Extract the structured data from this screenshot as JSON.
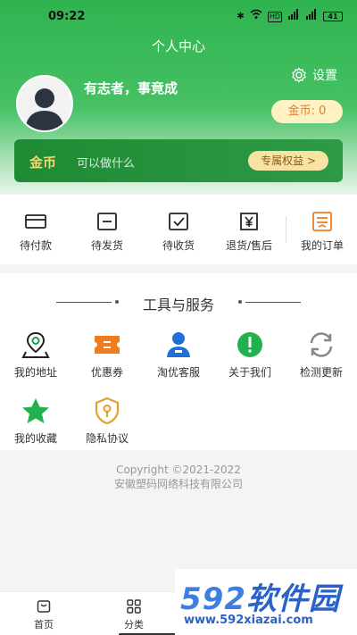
{
  "status_bar": {
    "time": "09:22",
    "icons": [
      "bluetooth-icon",
      "wifi-icon",
      "hd-icon",
      "signal-5g-icon",
      "signal-icon",
      "battery-icon"
    ],
    "hd": "HD",
    "network": "5G",
    "battery": "41"
  },
  "header": {
    "title": "个人中心",
    "username": "有志者，事竟成",
    "settings_label": "设置",
    "coin_badge": "金币: 0"
  },
  "coin_card": {
    "title": "金币",
    "subtitle": "可以做什么",
    "button": "专属权益 >"
  },
  "orders": {
    "items": [
      {
        "label": "待付款",
        "icon": "card-icon"
      },
      {
        "label": "待发货",
        "icon": "box-icon"
      },
      {
        "label": "待收货",
        "icon": "check-box-icon"
      },
      {
        "label": "退货/售后",
        "icon": "refund-icon"
      },
      {
        "label": "我的订单",
        "icon": "order-list-icon"
      }
    ]
  },
  "tools": {
    "title": "工具与服务",
    "items": [
      {
        "label": "我的地址",
        "icon": "location-icon"
      },
      {
        "label": "优惠券",
        "icon": "coupon-icon"
      },
      {
        "label": "淘优客服",
        "icon": "service-icon"
      },
      {
        "label": "关于我们",
        "icon": "info-icon"
      },
      {
        "label": "检测更新",
        "icon": "refresh-icon"
      },
      {
        "label": "我的收藏",
        "icon": "star-icon"
      },
      {
        "label": "隐私协议",
        "icon": "privacy-shield-icon"
      }
    ]
  },
  "copyright": {
    "line1": "Copyright ©2021-2022",
    "line2": "安徽塑码网络科技有限公司"
  },
  "tabbar": {
    "items": [
      {
        "label": "首页",
        "icon": "home-icon"
      },
      {
        "label": "分类",
        "icon": "category-icon"
      },
      {
        "label": "",
        "icon": "cart-icon"
      },
      {
        "label": "",
        "icon": "profile-icon"
      }
    ]
  },
  "watermark": {
    "brand_num": "592",
    "brand_cn": "软件园",
    "url": "www.592xiazai.com"
  },
  "colors": {
    "brand_green": "#2fb34f",
    "card_green": "#1f8a34",
    "coin_gold": "#f8d66a",
    "orange": "#f07c1e",
    "blue": "#1e6fd8"
  }
}
